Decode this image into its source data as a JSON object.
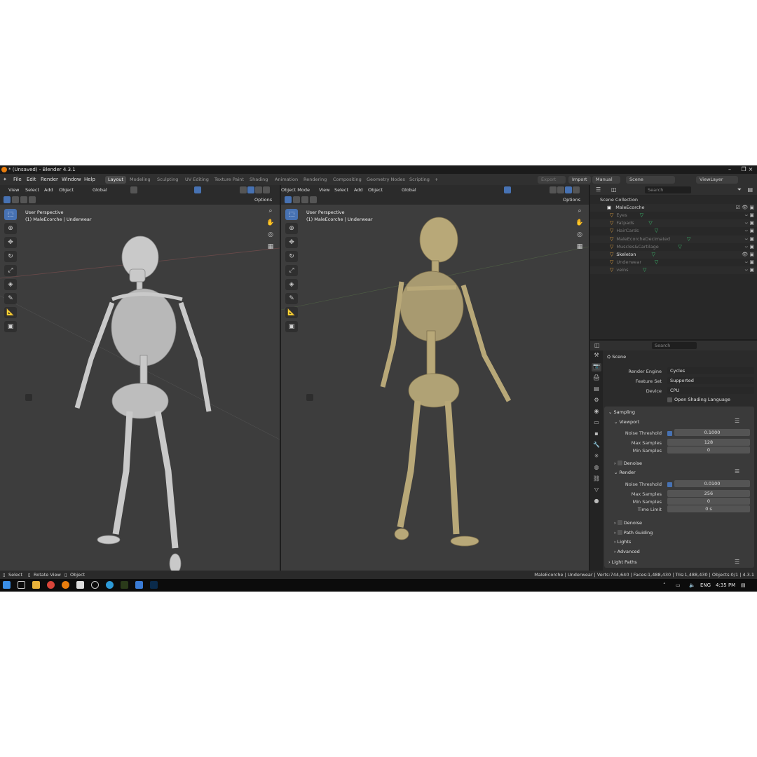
{
  "window": {
    "title": "* (Unsaved) - Blender 4.3.1"
  },
  "menu": [
    "File",
    "Edit",
    "Render",
    "Window",
    "Help"
  ],
  "workspaces": [
    "Layout",
    "Modeling",
    "Sculpting",
    "UV Editing",
    "Texture Paint",
    "Shading",
    "Animation",
    "Rendering",
    "Compositing",
    "Geometry Nodes",
    "Scripting",
    "+"
  ],
  "top_right": {
    "export": "Export",
    "import": "Import",
    "manual": "Manual",
    "scene": "Scene",
    "view_layer": "ViewLayer"
  },
  "viewport_left": {
    "menus": [
      "View",
      "Select",
      "Add",
      "Object"
    ],
    "transform": "Global",
    "options": "Options",
    "perspective": "User Perspective",
    "context": "(1) MaleEcorche | Underwear"
  },
  "viewport_right": {
    "mode": "Object Mode",
    "menus": [
      "View",
      "Select",
      "Add",
      "Object"
    ],
    "transform": "Global",
    "options": "Options",
    "perspective": "User Perspective",
    "context": "(1) MaleEcorche | Underwear"
  },
  "outliner": {
    "search_placeholder": "Search",
    "root": "Scene Collection",
    "collection": "MaleEcorche",
    "items": [
      {
        "name": "Eyes",
        "visible": false
      },
      {
        "name": "Fatpads",
        "visible": false
      },
      {
        "name": "HairCards",
        "visible": false
      },
      {
        "name": "MaleEcorcheDecimated",
        "visible": false
      },
      {
        "name": "Muscles&Cartilage",
        "visible": false
      },
      {
        "name": "Skeleton",
        "visible": true
      },
      {
        "name": "Underwear",
        "visible": false
      },
      {
        "name": "veins",
        "visible": false
      }
    ]
  },
  "properties": {
    "search_placeholder": "Search",
    "context": "Scene",
    "render_engine_label": "Render Engine",
    "render_engine": "Cycles",
    "feature_set_label": "Feature Set",
    "feature_set": "Supported",
    "device_label": "Device",
    "device": "CPU",
    "osl_label": "Open Shading Language",
    "sampling": "Sampling",
    "viewport": "Viewport",
    "noise_threshold_label": "Noise Threshold",
    "viewport_noise_threshold": "0.1000",
    "max_samples_label": "Max Samples",
    "viewport_max_samples": "128",
    "min_samples_label": "Min Samples",
    "viewport_min_samples": "0",
    "denoise": "Denoise",
    "render": "Render",
    "render_noise_threshold": "0.0100",
    "render_max_samples": "256",
    "render_min_samples": "0",
    "time_limit_label": "Time Limit",
    "time_limit": "0 s",
    "render_denoise": "Denoise",
    "path_guiding": "Path Guiding",
    "lights": "Lights",
    "advanced": "Advanced",
    "light_paths": "Light Paths"
  },
  "statusbar": {
    "select": "Select",
    "rotate": "Rotate View",
    "object": "Object",
    "stats": "MaleEcorche | Underwear | Verts:744,640 | Faces:1,488,430 | Tris:1,488,430 | Objects:0/1 | 4.3.1"
  },
  "taskbar": {
    "lang": "ENG",
    "time": "4:35 PM"
  },
  "colors": {
    "accent": "#4772b3",
    "bone_left": "#c9c9c9",
    "bone_right": "#b8a878",
    "viewport_bg": "#3d3d3d"
  }
}
